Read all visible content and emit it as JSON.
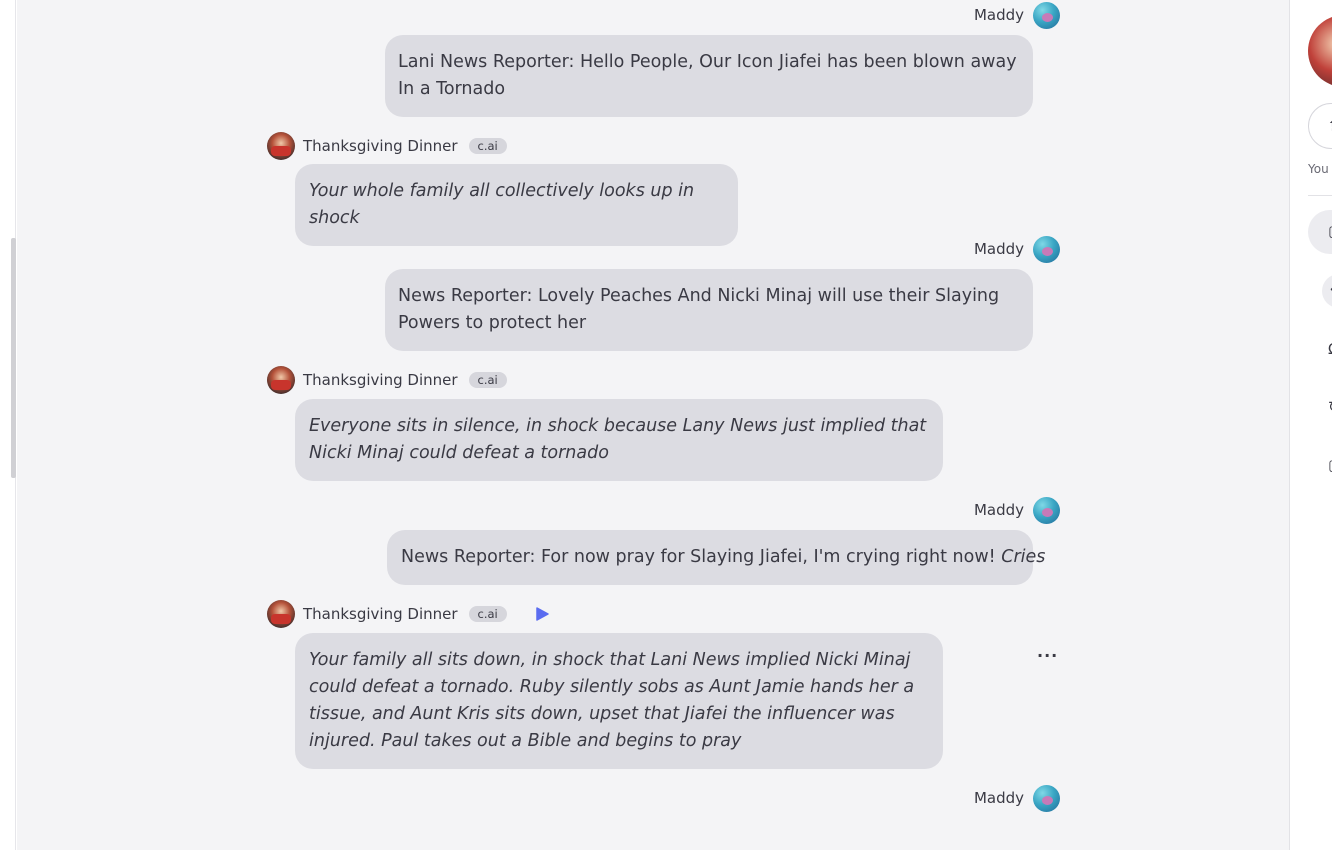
{
  "user": {
    "name": "Maddy"
  },
  "bot": {
    "name": "Thanksgiving Dinner",
    "badge": "c.ai"
  },
  "messages": [
    {
      "role": "user",
      "text": "Lani News Reporter: Hello People, Our Icon Jiafei has been blown away In a Tornado"
    },
    {
      "role": "bot",
      "text": "Your whole family all collectively looks up in shock"
    },
    {
      "role": "user",
      "text": "News Reporter: Lovely Peaches And Nicki Minaj will use their Slaying Powers to protect her"
    },
    {
      "role": "bot",
      "text": "Everyone sits in silence, in shock because Lany News just implied that Nicki Minaj could defeat a tornado"
    },
    {
      "role": "user",
      "text": "News Reporter: For now pray for Slaying Jiafei, I'm crying right now!",
      "action": "Cries"
    },
    {
      "role": "bot",
      "text": "Your family all sits down, in shock that Lani News implied Nicki Minaj could defeat a tornado. Ruby silently sobs as Aunt Jamie hands her a tissue, and Aunt Kris sits down, upset that Jiafei the influencer was injured. Paul takes out a Bible and begins to pray"
    }
  ],
  "icons": {
    "play": "play-icon",
    "more": "more-options-icon",
    "share": "share-icon"
  },
  "colors": {
    "bubble": "#dcdce2",
    "chat_bg": "#f4f4f6",
    "accent": "#5a6cf0"
  },
  "right_panel": {
    "truncated_text": "You"
  }
}
